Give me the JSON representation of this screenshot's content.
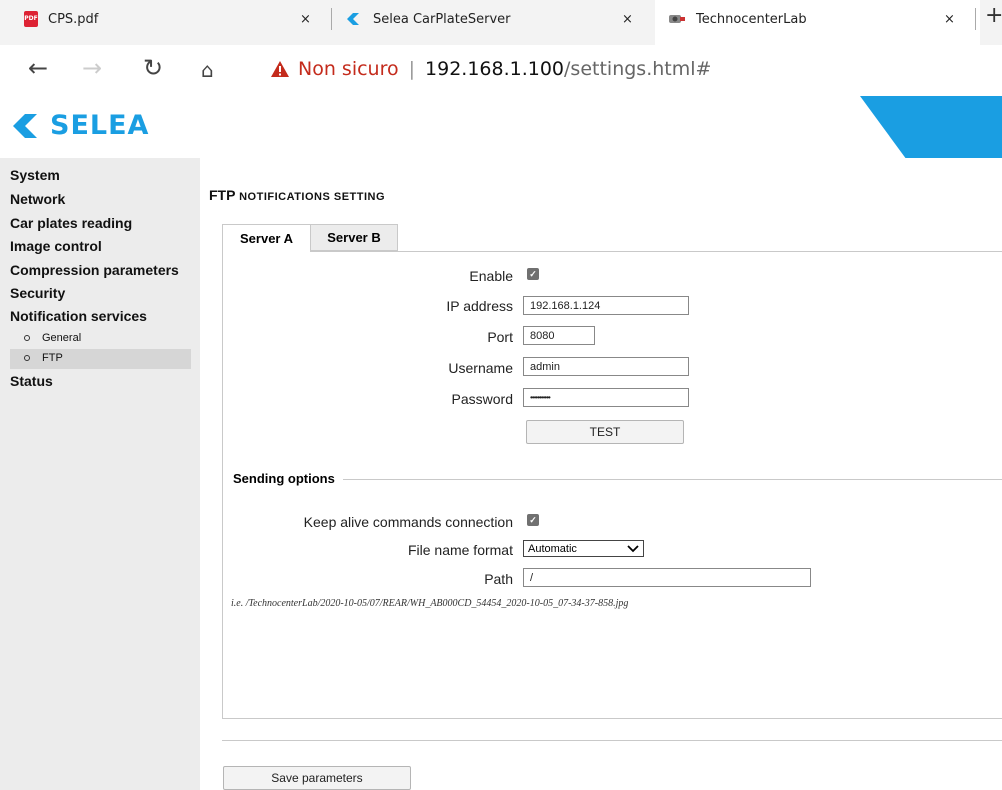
{
  "browser": {
    "tabs": [
      {
        "title": "CPS.pdf",
        "icon": "pdf-icon"
      },
      {
        "title": "Selea CarPlateServer",
        "icon": "selea-icon"
      },
      {
        "title": "TechnocenterLab",
        "icon": "camera-icon"
      }
    ],
    "close_glyph": "×",
    "new_tab_glyph": "+",
    "security_warning": "Non sicuro",
    "url_host": "192.168.1.100",
    "url_path": "/settings.html#",
    "divider": "|"
  },
  "header": {
    "logo_text": "SELEA",
    "brand_color": "#1a9ee2"
  },
  "sidebar": {
    "items": [
      {
        "label": "System"
      },
      {
        "label": "Network"
      },
      {
        "label": "Car plates reading"
      },
      {
        "label": "Image control"
      },
      {
        "label": "Compression parameters"
      },
      {
        "label": "Security"
      },
      {
        "label": "Notification services"
      }
    ],
    "sub_items": [
      {
        "label": "General"
      },
      {
        "label": "FTP",
        "selected": true
      }
    ],
    "last_item": {
      "label": "Status"
    }
  },
  "main": {
    "title_big": "FTP",
    "title_small": "NOTIFICATIONS SETTING",
    "tabs": [
      {
        "label": "Server A",
        "active": true
      },
      {
        "label": "Server B",
        "active": false
      }
    ],
    "form": {
      "enable_label": "Enable",
      "enable_checked": true,
      "ip_label": "IP address",
      "ip_value": "192.168.1.124",
      "port_label": "Port",
      "port_value": "8080",
      "username_label": "Username",
      "username_value": "admin",
      "password_label": "Password",
      "password_value": "•••••••••••",
      "test_button": "TEST"
    },
    "sending": {
      "legend": "Sending options",
      "keep_alive_label": "Keep alive commands connection",
      "keep_alive_checked": true,
      "file_format_label": "File name format",
      "file_format_value": "Automatic",
      "path_label": "Path",
      "path_value": "/",
      "example": "i.e. /TechnocenterLab/2020-10-05/07/REAR/WH_AB000CD_54454_2020-10-05_07-34-37-858.jpg"
    },
    "save_button": "Save parameters"
  }
}
